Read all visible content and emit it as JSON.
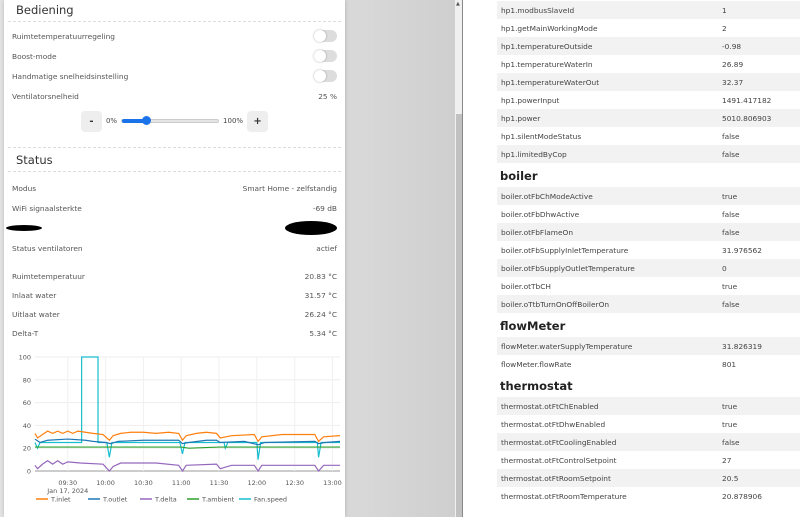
{
  "controls": {
    "title": "Bediening",
    "toggles": [
      {
        "label": "Ruimtetemperatuurregeling",
        "on": false
      },
      {
        "label": "Boost-mode",
        "on": false
      },
      {
        "label": "Handmatige snelheidsinstelling",
        "on": false
      }
    ],
    "fan_speed_label": "Ventilatorsnelheid",
    "fan_speed_value": "25 %",
    "slider_min": "0%",
    "slider_max": "100%",
    "slider_fraction": 0.25,
    "minus": "-",
    "plus": "+"
  },
  "status": {
    "title": "Status",
    "rows": [
      {
        "label": "Modus",
        "value": "Smart Home - zelfstandig"
      },
      {
        "label": "WiFi signaalsterkte",
        "value": "-69 dB"
      }
    ],
    "fan_status_label": "Status ventilatoren",
    "fan_status_value": "actief",
    "temps": [
      {
        "label": "Ruimtetemperatuur",
        "value": "20.83 °C"
      },
      {
        "label": "Inlaat water",
        "value": "31.57 °C"
      },
      {
        "label": "Uitlaat water",
        "value": "26.24 °C"
      },
      {
        "label": "Delta-T",
        "value": "5.34 °C"
      }
    ]
  },
  "chart_data": {
    "type": "line",
    "xlabel": "",
    "ylabel": "",
    "ylim": [
      0,
      100
    ],
    "xlim_minutes_from_0900": [
      4,
      246
    ],
    "y_ticks": [
      "0",
      "20",
      "40",
      "60",
      "80",
      "100"
    ],
    "y_tick_values": [
      0,
      20,
      40,
      60,
      80,
      100
    ],
    "x_ticks": [
      "09:30",
      "10:00",
      "10:30",
      "11:00",
      "11:30",
      "12:00",
      "12:30",
      "13:00"
    ],
    "x_tick_minutes": [
      30,
      60,
      90,
      120,
      150,
      180,
      210,
      240
    ],
    "x_date_label": "Jan 17, 2024",
    "series": [
      {
        "name": "T.inlet",
        "color": "#ff7f0e",
        "points": [
          [
            4,
            33
          ],
          [
            6,
            29
          ],
          [
            10,
            32
          ],
          [
            14,
            35
          ],
          [
            18,
            33
          ],
          [
            22,
            35
          ],
          [
            26,
            33
          ],
          [
            30,
            35
          ],
          [
            34,
            33
          ],
          [
            38,
            35
          ],
          [
            44,
            34
          ],
          [
            50,
            33
          ],
          [
            58,
            32
          ],
          [
            63,
            27
          ],
          [
            66,
            31
          ],
          [
            72,
            33
          ],
          [
            80,
            34
          ],
          [
            90,
            34
          ],
          [
            100,
            33
          ],
          [
            110,
            34
          ],
          [
            118,
            33
          ],
          [
            121,
            27
          ],
          [
            124,
            31
          ],
          [
            132,
            33
          ],
          [
            140,
            34
          ],
          [
            148,
            33
          ],
          [
            151,
            29
          ],
          [
            160,
            31
          ],
          [
            178,
            32
          ],
          [
            181,
            26
          ],
          [
            184,
            30
          ],
          [
            200,
            32
          ],
          [
            226,
            32
          ],
          [
            229,
            26
          ],
          [
            233,
            30
          ],
          [
            246,
            31
          ]
        ]
      },
      {
        "name": "T.outlet",
        "color": "#1f77b4",
        "points": [
          [
            4,
            28
          ],
          [
            8,
            25
          ],
          [
            14,
            27
          ],
          [
            30,
            28
          ],
          [
            44,
            27
          ],
          [
            50,
            26
          ],
          [
            60,
            25
          ],
          [
            64,
            24
          ],
          [
            70,
            26
          ],
          [
            90,
            27
          ],
          [
            118,
            27
          ],
          [
            121,
            24
          ],
          [
            126,
            25
          ],
          [
            140,
            27
          ],
          [
            148,
            27
          ],
          [
            151,
            25
          ],
          [
            170,
            26
          ],
          [
            181,
            23
          ],
          [
            186,
            25
          ],
          [
            226,
            26
          ],
          [
            229,
            24
          ],
          [
            234,
            25
          ],
          [
            246,
            26
          ]
        ]
      },
      {
        "name": "T.delta",
        "color": "#9467bd",
        "points": [
          [
            4,
            5
          ],
          [
            6,
            2
          ],
          [
            10,
            6
          ],
          [
            14,
            9
          ],
          [
            18,
            6
          ],
          [
            22,
            9
          ],
          [
            26,
            6
          ],
          [
            30,
            8
          ],
          [
            40,
            7
          ],
          [
            58,
            6
          ],
          [
            63,
            0
          ],
          [
            66,
            4
          ],
          [
            72,
            7
          ],
          [
            100,
            7
          ],
          [
            118,
            5
          ],
          [
            121,
            0
          ],
          [
            124,
            5
          ],
          [
            148,
            6
          ],
          [
            151,
            2
          ],
          [
            160,
            5
          ],
          [
            178,
            5
          ],
          [
            181,
            0
          ],
          [
            184,
            5
          ],
          [
            226,
            5
          ],
          [
            229,
            0
          ],
          [
            233,
            5
          ],
          [
            246,
            5
          ]
        ]
      },
      {
        "name": "T.ambient",
        "color": "#2ca02c",
        "points": [
          [
            4,
            21
          ],
          [
            120,
            21
          ],
          [
            126,
            20
          ],
          [
            150,
            21
          ],
          [
            246,
            21
          ]
        ]
      },
      {
        "name": "Fan.speed",
        "color": "#17becf",
        "points": [
          [
            4,
            25
          ],
          [
            6,
            20
          ],
          [
            8,
            25
          ],
          [
            41,
            25
          ],
          [
            41,
            100
          ],
          [
            54,
            100
          ],
          [
            54,
            25
          ],
          [
            61,
            25
          ],
          [
            63,
            12
          ],
          [
            65,
            25
          ],
          [
            119,
            25
          ],
          [
            121,
            15
          ],
          [
            123,
            25
          ],
          [
            154,
            25
          ],
          [
            155,
            20
          ],
          [
            157,
            25
          ],
          [
            180,
            25
          ],
          [
            181,
            10
          ],
          [
            183,
            25
          ],
          [
            228,
            25
          ],
          [
            229,
            12
          ],
          [
            231,
            25
          ],
          [
            246,
            25
          ]
        ]
      }
    ]
  },
  "table": {
    "groups": [
      {
        "title": "",
        "rows": [
          [
            "hp1.modbusSlaveId",
            "1"
          ],
          [
            "hp1.getMainWorkingMode",
            "2"
          ],
          [
            "hp1.temperatureOutside",
            "-0.98"
          ],
          [
            "hp1.temperatureWaterIn",
            "26.89"
          ],
          [
            "hp1.temperatureWaterOut",
            "32.37"
          ],
          [
            "hp1.powerInput",
            "1491.417182"
          ],
          [
            "hp1.power",
            "5010.806903"
          ],
          [
            "hp1.silentModeStatus",
            "false"
          ],
          [
            "hp1.limitedByCop",
            "false"
          ]
        ]
      },
      {
        "title": "boiler",
        "rows": [
          [
            "boiler.otFbChModeActive",
            "true"
          ],
          [
            "boiler.otFbDhwActive",
            "false"
          ],
          [
            "boiler.otFbFlameOn",
            "false"
          ],
          [
            "boiler.otFbSupplyInletTemperature",
            "31.976562"
          ],
          [
            "boiler.otFbSupplyOutletTemperature",
            "0"
          ],
          [
            "boiler.otTbCH",
            "true"
          ],
          [
            "boiler.oTtbTurnOnOffBoilerOn",
            "false"
          ]
        ]
      },
      {
        "title": "flowMeter",
        "rows": [
          [
            "flowMeter.waterSupplyTemperature",
            "31.826319"
          ],
          [
            "flowMeter.flowRate",
            "801"
          ]
        ]
      },
      {
        "title": "thermostat",
        "rows": [
          [
            "thermostat.otFtChEnabled",
            "true"
          ],
          [
            "thermostat.otFtDhwEnabled",
            "true"
          ],
          [
            "thermostat.otFtCoolingEnabled",
            "false"
          ],
          [
            "thermostat.otFtControlSetpoint",
            "27"
          ],
          [
            "thermostat.otFtRoomSetpoint",
            "20.5"
          ],
          [
            "thermostat.otFtRoomTemperature",
            "20.878906"
          ]
        ]
      }
    ]
  }
}
